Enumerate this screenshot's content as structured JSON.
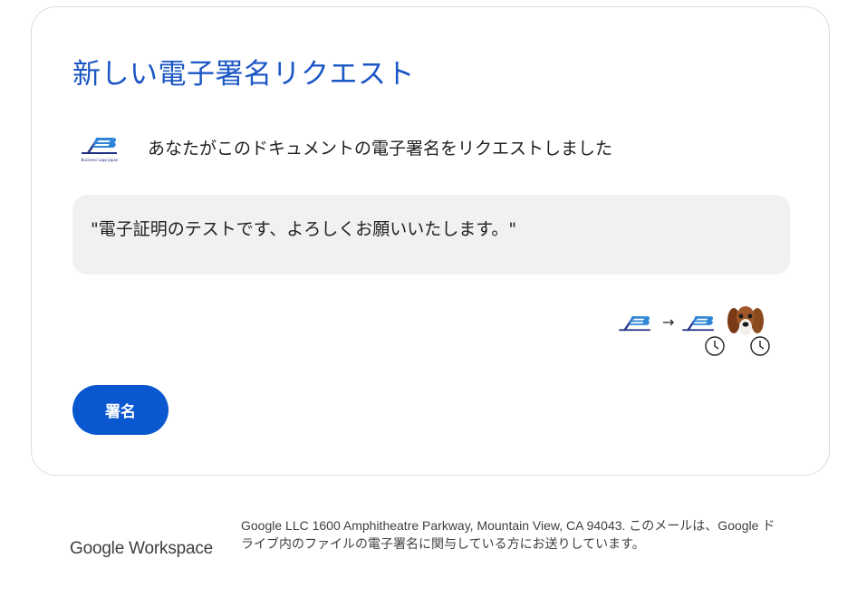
{
  "card": {
    "title": "新しい電子署名リクエスト",
    "sender_text": "あなたがこのドキュメントの電子署名をリクエストしました",
    "sender_logo_caption": "Business Logo Japan",
    "message": "\"電子証明のテストです、よろしくお願いいたします。\"",
    "flow_arrow": "→",
    "sign_button_label": "署名"
  },
  "footer": {
    "brand": "Google Workspace",
    "legal_text": "Google LLC 1600 Amphitheatre Parkway, Mountain View, CA 94043. このメールは、Google ドライブ内のファイルの電子署名に関与している方にお送りしています。"
  },
  "colors": {
    "title": "#1a56c4",
    "logo_navy": "#1f2f86",
    "logo_blue": "#2f86d8",
    "button": "#0b57d0",
    "message_bg": "#f1f1f1",
    "card_border": "#dadce0"
  },
  "icons": {
    "sender_logo": "business-logo-icon",
    "clock": "clock-icon",
    "avatar": "dog-avatar"
  }
}
